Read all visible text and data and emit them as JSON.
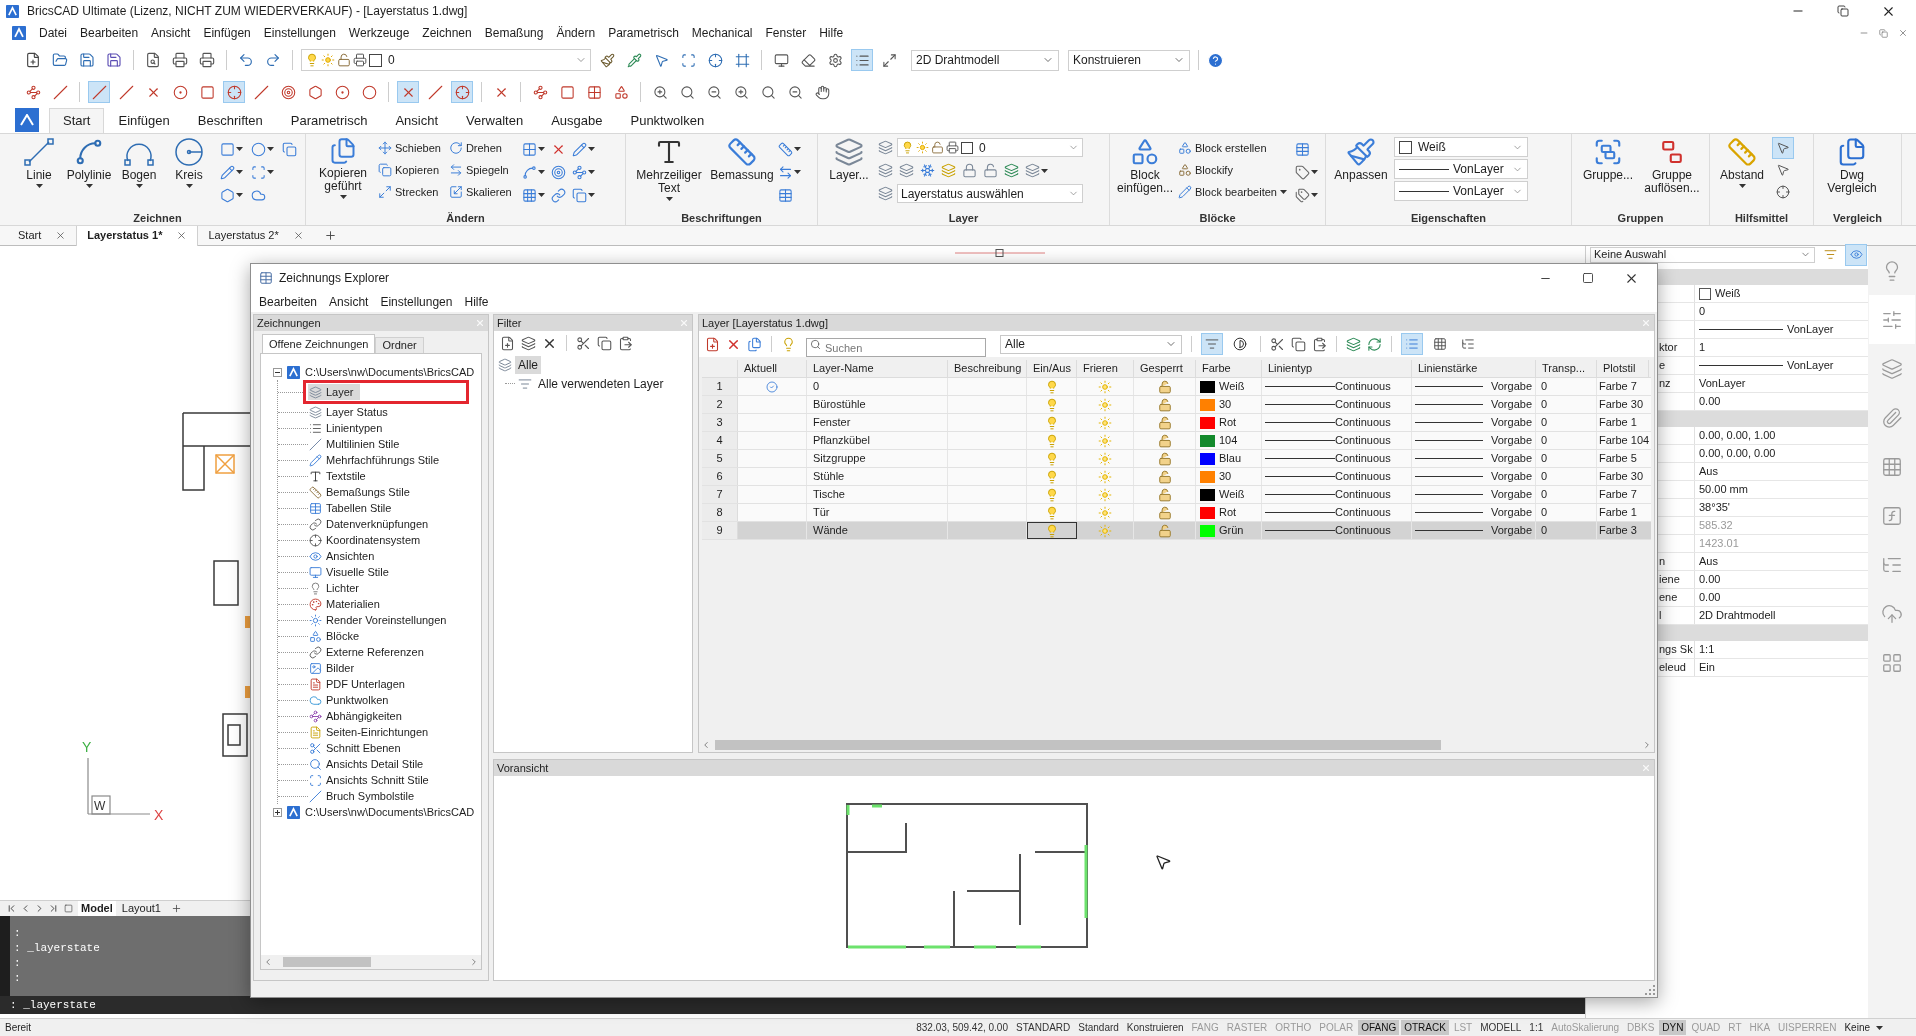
{
  "window": {
    "title": "BricsCAD Ultimate (Lizenz, NICHT ZUM WIEDERVERKAUF) - [Layerstatus 1.dwg]"
  },
  "menu_bar": [
    "Datei",
    "Bearbeiten",
    "Ansicht",
    "Einfügen",
    "Einstellungen",
    "Werkzeuge",
    "Zeichnen",
    "Bemaßung",
    "Ändern",
    "Parametrisch",
    "Mechanical",
    "Fenster",
    "Hilfe"
  ],
  "toolbar_1": {
    "layer_combo": "0",
    "tools": [
      {
        "active": false
      },
      {
        "active": false
      },
      {
        "active": false
      },
      {
        "active": false
      },
      {
        "active": false
      },
      {
        "active": false
      },
      {
        "active": false
      },
      {
        "active": false
      },
      {
        "active": false
      },
      {
        "active": true
      },
      {
        "active": false
      }
    ],
    "visual_style_combo": "2D Drahtmodell",
    "workspace_combo": "Konstruieren"
  },
  "snap_toolbar": [
    {
      "active": false
    },
    {
      "active": false
    },
    {
      "active": true
    },
    {
      "active": false
    },
    {
      "active": false
    },
    {
      "active": false
    },
    {
      "active": false
    },
    {
      "active": true
    },
    {
      "active": false
    },
    {
      "active": false
    },
    {
      "active": false
    },
    {
      "active": false
    },
    {
      "active": false
    },
    {
      "active": true
    },
    {
      "active": false
    },
    {
      "active": true
    },
    {
      "active": false
    },
    {
      "active": false
    },
    {
      "active": false
    },
    {
      "active": false
    },
    {
      "active": false
    },
    {
      "active": false
    },
    {
      "active": false
    },
    {
      "active": false
    },
    {
      "active": false
    },
    {
      "active": false
    },
    {
      "active": false
    },
    {
      "active": false
    }
  ],
  "ribbon": {
    "tabs": [
      {
        "label": "Start",
        "selected": true
      },
      {
        "label": "Einfügen",
        "selected": false
      },
      {
        "label": "Beschriften",
        "selected": false
      },
      {
        "label": "Parametrisch",
        "selected": false
      },
      {
        "label": "Ansicht",
        "selected": false
      },
      {
        "label": "Verwalten",
        "selected": false
      },
      {
        "label": "Ausgabe",
        "selected": false
      },
      {
        "label": "Punktwolken",
        "selected": false
      }
    ],
    "groups": {
      "zeichnen": {
        "title": "Zeichnen",
        "tools": [
          "Linie",
          "Polylinie",
          "Bogen",
          "Kreis"
        ]
      },
      "aendern": {
        "title": "Ändern",
        "large": "Kopieren geführt",
        "tools": [
          "Schieben",
          "Kopieren",
          "Strecken",
          "Drehen",
          "Spiegeln",
          "Skalieren"
        ]
      },
      "beschriftungen": {
        "title": "Beschriftungen",
        "tools": [
          "Mehrzeiliger Text",
          "Bemassung"
        ]
      },
      "layer": {
        "title": "Layer",
        "large": "Layer...",
        "layer_combo": "0",
        "state_combo": "Layerstatus auswählen"
      },
      "bloecke": {
        "title": "Blöcke",
        "large": "Block einfügen...",
        "tools": [
          "Block erstellen",
          "Blockify",
          "Block bearbeiten"
        ]
      },
      "eigenschaften": {
        "title": "Eigenschaften",
        "large": "Anpassen",
        "color_combo": "Weiß",
        "linetype_combo": "VonLayer",
        "lineweight_combo": "VonLayer"
      },
      "gruppen": {
        "title": "Gruppen",
        "tools": [
          "Gruppe...",
          "Gruppe auflösen..."
        ]
      },
      "hilfsmittel": {
        "title": "Hilfsmittel",
        "large": "Abstand",
        "tools": [
          {
            "active": true
          },
          {
            "active": false
          },
          {
            "active": false
          }
        ]
      },
      "vergleich": {
        "title": "Vergleich",
        "large": "Dwg Vergleich"
      }
    }
  },
  "document_tabs": [
    {
      "label": "Start",
      "selected": false
    },
    {
      "label": "Layerstatus 1*",
      "selected": true
    },
    {
      "label": "Layerstatus 2*",
      "selected": false
    }
  ],
  "canvas": {
    "ucs": {
      "y_axis": "Y",
      "origin": "W",
      "x_axis": "X"
    }
  },
  "layout_tabs": [
    {
      "label": "Model",
      "selected": true
    },
    {
      "label": "Layout1",
      "selected": false
    }
  ],
  "command_history": [
    ":",
    ": _layerstate",
    ":",
    ":"
  ],
  "command_line": ": _layerstate",
  "properties": {
    "selection_combo": "Keine Auswahl",
    "toggles": [
      {
        "active": false
      },
      {
        "active": true
      }
    ],
    "rows": [
      {
        "kind": "section"
      },
      {
        "kind": "color",
        "value": "Weiß"
      },
      {
        "kind": "text",
        "value": "0"
      },
      {
        "kind": "linetype",
        "value": "VonLayer"
      },
      {
        "kind": "text",
        "label": "ktor",
        "value": "1"
      },
      {
        "kind": "linetype",
        "label": "e",
        "value": "VonLayer"
      },
      {
        "kind": "text",
        "label": "nz",
        "value": "VonLayer"
      },
      {
        "kind": "text",
        "value": "0.00"
      },
      {
        "kind": "section"
      },
      {
        "kind": "text",
        "value": "0.00, 0.00, 1.00"
      },
      {
        "kind": "text",
        "value": "0.00, 0.00, 0.00"
      },
      {
        "kind": "text",
        "value": "Aus"
      },
      {
        "kind": "text",
        "value": "50.00 mm"
      },
      {
        "kind": "text",
        "value": "38°35'"
      },
      {
        "kind": "readonly",
        "value": "585.32"
      },
      {
        "kind": "readonly",
        "value": "1423.01"
      },
      {
        "kind": "text",
        "label": "n",
        "value": "Aus"
      },
      {
        "kind": "text",
        "label": "iene",
        "value": "0.00"
      },
      {
        "kind": "text",
        "label": "ene",
        "value": "0.00"
      },
      {
        "kind": "text",
        "label": "l",
        "value": "2D Drahtmodell"
      },
      {
        "kind": "section"
      },
      {
        "kind": "text",
        "label": "ngs Sk",
        "value": "1:1"
      },
      {
        "kind": "text",
        "label": "eleud",
        "value": "Ein"
      }
    ]
  },
  "side_tabs": [
    {
      "selected": false
    },
    {
      "selected": true
    },
    {
      "selected": false
    },
    {
      "selected": false
    },
    {
      "selected": false
    },
    {
      "selected": false
    },
    {
      "selected": false
    },
    {
      "selected": false
    },
    {
      "selected": false
    }
  ],
  "explorer": {
    "title": "Zeichnungs Explorer",
    "menu": [
      "Bearbeiten",
      "Ansicht",
      "Einstellungen",
      "Hilfe"
    ],
    "drawings_pane": {
      "title": "Zeichnungen",
      "tabs": [
        {
          "label": "Offene Zeichnungen",
          "selected": true
        },
        {
          "label": "Ordner",
          "selected": false
        }
      ],
      "tree": [
        {
          "label": "C:\\Users\\nw\\Documents\\BricsCAD",
          "expanded": true,
          "children": [
            {
              "label": "Layer",
              "selected": true,
              "marked": true
            },
            {
              "label": "Layer Status",
              "selected": false,
              "marked": false
            },
            {
              "label": "Linientypen",
              "selected": false,
              "marked": false
            },
            {
              "label": "Multilinien Stile",
              "selected": false,
              "marked": false
            },
            {
              "label": "Mehrfachführungs Stile",
              "selected": false,
              "marked": false
            },
            {
              "label": "Textstile",
              "selected": false,
              "marked": false
            },
            {
              "label": "Bemaßungs Stile",
              "selected": false,
              "marked": false
            },
            {
              "label": "Tabellen Stile",
              "selected": false,
              "marked": false
            },
            {
              "label": "Datenverknüpfungen",
              "selected": false,
              "marked": false
            },
            {
              "label": "Koordinatensystem",
              "selected": false,
              "marked": false
            },
            {
              "label": "Ansichten",
              "selected": false,
              "marked": false
            },
            {
              "label": "Visuelle Stile",
              "selected": false,
              "marked": false
            },
            {
              "label": "Lichter",
              "selected": false,
              "marked": false
            },
            {
              "label": "Materialien",
              "selected": false,
              "marked": false
            },
            {
              "label": "Render Voreinstellungen",
              "selected": false,
              "marked": false
            },
            {
              "label": "Blöcke",
              "selected": false,
              "marked": false
            },
            {
              "label": "Externe Referenzen",
              "selected": false,
              "marked": false
            },
            {
              "label": "Bilder",
              "selected": false,
              "marked": false
            },
            {
              "label": "PDF Unterlagen",
              "selected": false,
              "marked": false
            },
            {
              "label": "Punktwolken",
              "selected": false,
              "marked": false
            },
            {
              "label": "Abhängigkeiten",
              "selected": false,
              "marked": false
            },
            {
              "label": "Seiten-Einrichtungen",
              "selected": false,
              "marked": false
            },
            {
              "label": "Schnitt Ebenen",
              "selected": false,
              "marked": false
            },
            {
              "label": "Ansichts Detail Stile",
              "selected": false,
              "marked": false
            },
            {
              "label": "Ansichts Schnitt Stile",
              "selected": false,
              "marked": false
            },
            {
              "label": "Bruch Symbolstile",
              "selected": false,
              "marked": false
            }
          ]
        },
        {
          "label": "C:\\Users\\nw\\Documents\\BricsCAD",
          "expanded": false
        }
      ]
    },
    "filter_pane": {
      "title": "Filter",
      "tree": [
        {
          "label": "Alle",
          "selected": true,
          "children": [
            {
              "label": "Alle verwendeten Layer",
              "selected": false
            }
          ]
        }
      ]
    },
    "layer_pane": {
      "title": "Layer [Layerstatus 1.dwg]",
      "search": {
        "placeholder": "Suchen"
      },
      "filter_combo": "Alle",
      "filter_buttons": [
        {
          "active": true
        },
        {
          "active": false
        }
      ],
      "view_buttons": [
        {
          "active": true
        },
        {
          "active": false
        },
        {
          "active": false
        }
      ],
      "table": {
        "columns": [
          "Aktuell",
          "Layer-Name",
          "Beschreibung",
          "Ein/Aus",
          "Frieren",
          "Gesperrt",
          "Farbe",
          "Linientyp",
          "Linienstärke",
          "Transp...",
          "Plotstil"
        ],
        "rows": [
          {
            "number": "1",
            "current": true,
            "name": "0",
            "on": true,
            "frozen": false,
            "locked": false,
            "color": "#000000",
            "color_name": "Weiß",
            "linetype": "Continuous",
            "lineweight": "Vorgabe",
            "transparency": "0",
            "plot_style": "Farbe 7",
            "selected": false
          },
          {
            "number": "2",
            "current": false,
            "name": "Bürostühle",
            "on": true,
            "frozen": false,
            "locked": false,
            "color": "#ff8000",
            "color_name": "30",
            "linetype": "Continuous",
            "lineweight": "Vorgabe",
            "transparency": "0",
            "plot_style": "Farbe 30",
            "selected": false
          },
          {
            "number": "3",
            "current": false,
            "name": "Fenster",
            "on": true,
            "frozen": false,
            "locked": false,
            "color": "#ff0000",
            "color_name": "Rot",
            "linetype": "Continuous",
            "lineweight": "Vorgabe",
            "transparency": "0",
            "plot_style": "Farbe 1",
            "selected": false
          },
          {
            "number": "4",
            "current": false,
            "name": "Pflanzkübel",
            "on": true,
            "frozen": false,
            "locked": false,
            "color": "#138a2c",
            "color_name": "104",
            "linetype": "Continuous",
            "lineweight": "Vorgabe",
            "transparency": "0",
            "plot_style": "Farbe 104",
            "selected": false
          },
          {
            "number": "5",
            "current": false,
            "name": "Sitzgruppe",
            "on": true,
            "frozen": false,
            "locked": false,
            "color": "#0000ff",
            "color_name": "Blau",
            "linetype": "Continuous",
            "lineweight": "Vorgabe",
            "transparency": "0",
            "plot_style": "Farbe 5",
            "selected": false
          },
          {
            "number": "6",
            "current": false,
            "name": "Stühle",
            "on": true,
            "frozen": false,
            "locked": false,
            "color": "#ff8000",
            "color_name": "30",
            "linetype": "Continuous",
            "lineweight": "Vorgabe",
            "transparency": "0",
            "plot_style": "Farbe 30",
            "selected": false
          },
          {
            "number": "7",
            "current": false,
            "name": "Tische",
            "on": true,
            "frozen": false,
            "locked": false,
            "color": "#000000",
            "color_name": "Weiß",
            "linetype": "Continuous",
            "lineweight": "Vorgabe",
            "transparency": "0",
            "plot_style": "Farbe 7",
            "selected": false
          },
          {
            "number": "8",
            "current": false,
            "name": "Tür",
            "on": true,
            "frozen": false,
            "locked": false,
            "color": "#ff0000",
            "color_name": "Rot",
            "linetype": "Continuous",
            "lineweight": "Vorgabe",
            "transparency": "0",
            "plot_style": "Farbe 1",
            "selected": false
          },
          {
            "number": "9",
            "current": false,
            "name": "Wände",
            "on": true,
            "frozen": false,
            "locked": false,
            "color": "#00ff00",
            "color_name": "Grün",
            "linetype": "Continuous",
            "lineweight": "Vorgabe",
            "transparency": "0",
            "plot_style": "Farbe 3",
            "selected": true
          }
        ]
      }
    },
    "preview_pane": {
      "title": "Voransicht"
    }
  },
  "status_bar": {
    "message": "Bereit",
    "items": [
      {
        "kind": "text",
        "label": "832.03, 509.42, 0.00"
      },
      {
        "kind": "text",
        "label": "STANDARD"
      },
      {
        "kind": "text",
        "label": "Standard"
      },
      {
        "kind": "text",
        "label": "Konstruieren"
      },
      {
        "kind": "toggle",
        "label": "FANG",
        "on": false
      },
      {
        "kind": "toggle",
        "label": "RASTER",
        "on": false
      },
      {
        "kind": "toggle",
        "label": "ORTHO",
        "on": false
      },
      {
        "kind": "toggle",
        "label": "POLAR",
        "on": false
      },
      {
        "kind": "toggle",
        "label": "OFANG",
        "on": true
      },
      {
        "kind": "toggle",
        "label": "OTRACK",
        "on": true
      },
      {
        "kind": "toggle",
        "label": "LST",
        "on": false
      },
      {
        "kind": "text",
        "label": "MODELL"
      },
      {
        "kind": "text",
        "label": "1:1"
      },
      {
        "kind": "toggle",
        "label": "AutoSkalierung",
        "on": false
      },
      {
        "kind": "toggle",
        "label": "DBKS",
        "on": false
      },
      {
        "kind": "toggle",
        "label": "DYN",
        "on": true
      },
      {
        "kind": "toggle",
        "label": "QUAD",
        "on": false
      },
      {
        "kind": "toggle",
        "label": "RT",
        "on": false
      },
      {
        "kind": "toggle",
        "label": "HKA",
        "on": false
      },
      {
        "kind": "toggle",
        "label": "UISPERREN",
        "on": false
      },
      {
        "kind": "dropdown",
        "label": "Keine"
      }
    ]
  }
}
